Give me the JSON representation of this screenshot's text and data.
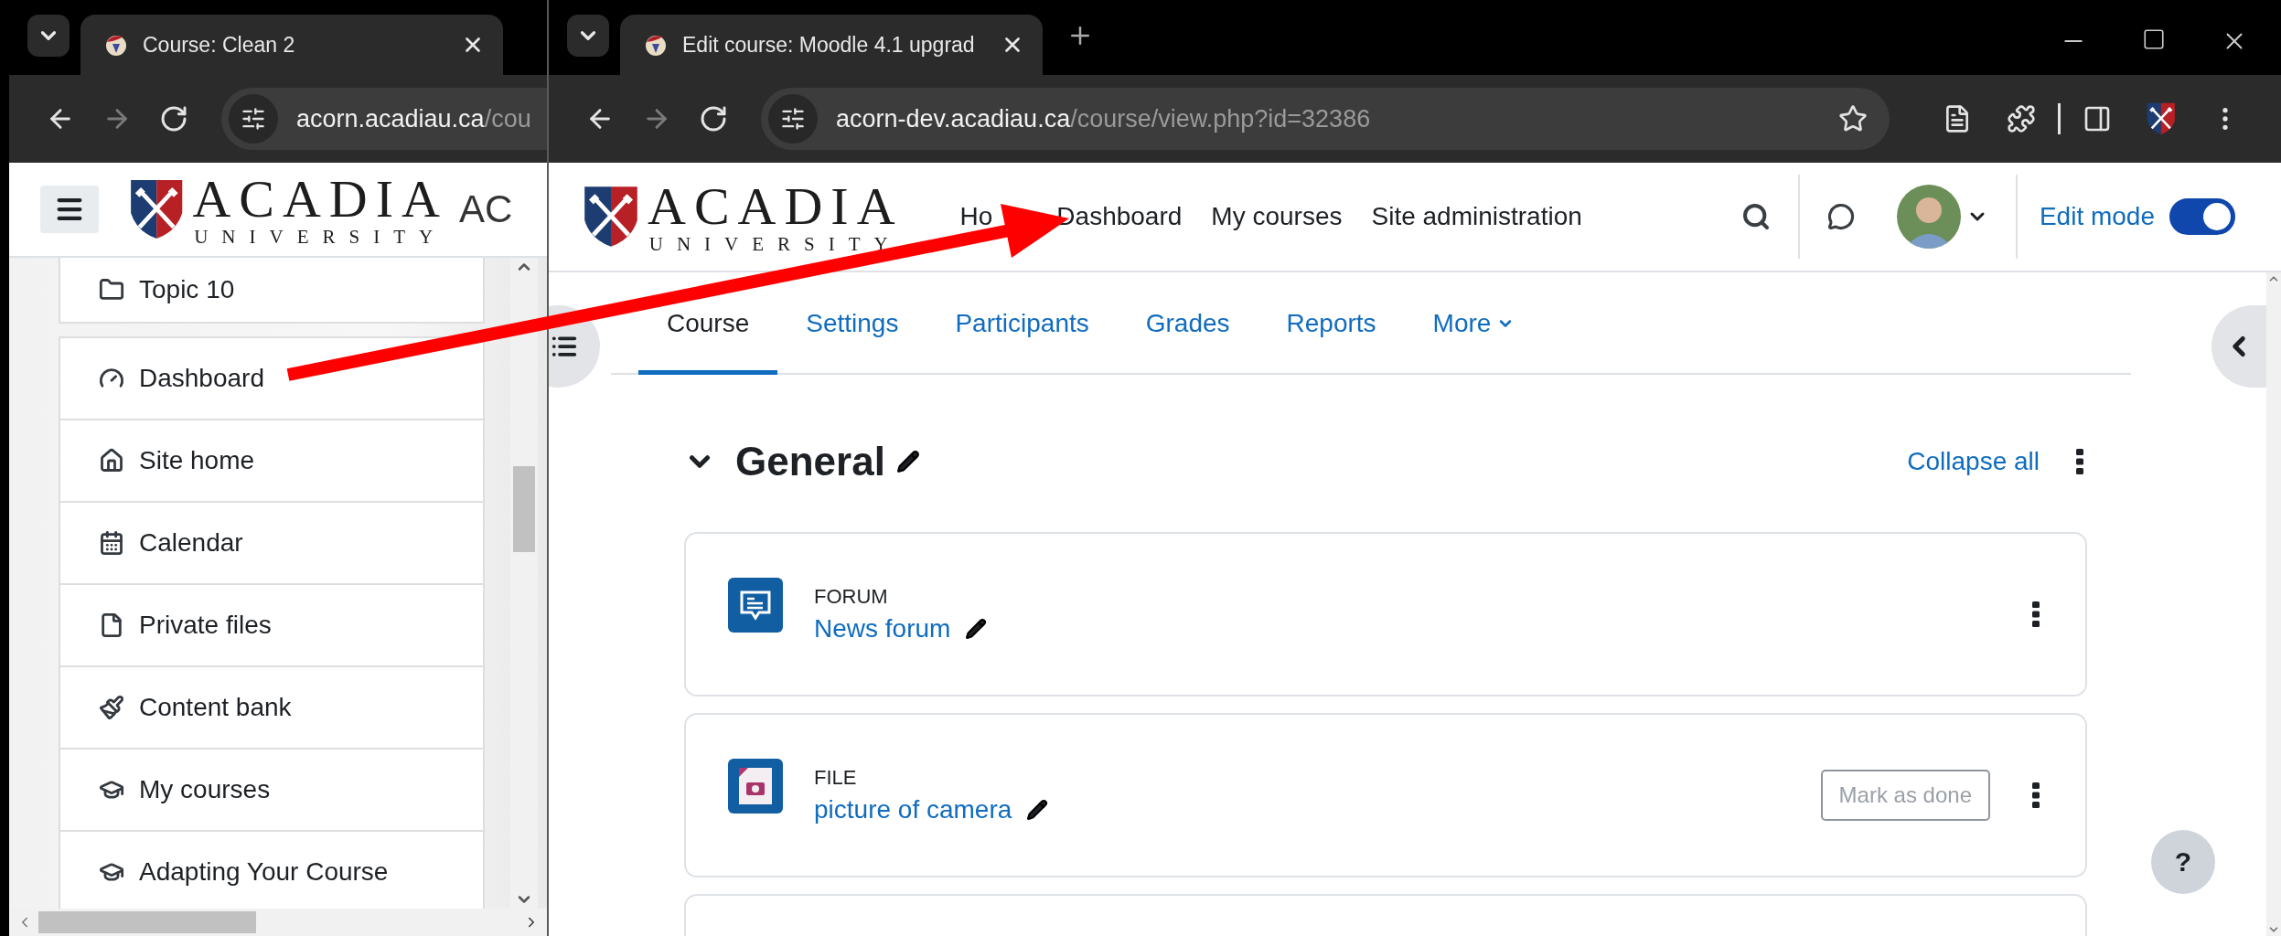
{
  "left_window": {
    "tab": {
      "title": "Course: Clean 2"
    },
    "nav_buttons": [
      {
        "kind": "back",
        "disabled": false
      },
      {
        "kind": "forward",
        "disabled": true
      },
      {
        "kind": "reload",
        "disabled": false
      }
    ],
    "address": {
      "host": "acorn.acadiau.ca",
      "path": "/cou"
    },
    "header": {
      "logo_name": "ACADIA",
      "logo_sub": "UNIVERSITY",
      "site_title": "AC"
    },
    "sidebar": {
      "sections": [
        {
          "items": [
            {
              "kind": "folder",
              "label": "Topic 10"
            }
          ]
        },
        {
          "items": [
            {
              "kind": "dashboard",
              "label": "Dashboard"
            },
            {
              "kind": "home",
              "label": "Site home"
            },
            {
              "kind": "calendar",
              "label": "Calendar"
            },
            {
              "kind": "file",
              "label": "Private files"
            },
            {
              "kind": "brush",
              "label": "Content bank"
            },
            {
              "kind": "courses",
              "label": "My courses"
            },
            {
              "kind": "course",
              "label": "Adapting Your Course"
            }
          ]
        }
      ]
    }
  },
  "right_window": {
    "tab": {
      "title": "Edit course: Moodle 4.1 upgrad"
    },
    "nav_buttons": [
      {
        "kind": "back",
        "disabled": false
      },
      {
        "kind": "forward",
        "disabled": true
      },
      {
        "kind": "reload",
        "disabled": false
      }
    ],
    "address": {
      "host": "acorn-dev.acadiau.ca",
      "path": "/course/view.php?id=32386"
    },
    "header": {
      "logo_name": "ACADIA",
      "logo_sub": "UNIVERSITY",
      "nav": [
        {
          "label": "Ho"
        },
        {
          "label": "Dashboard"
        },
        {
          "label": "My courses"
        },
        {
          "label": "Site administration"
        }
      ],
      "edit_mode": {
        "label": "Edit mode",
        "on": true
      }
    },
    "course_tabs": [
      {
        "label": "Course",
        "selected": true,
        "kind": "link"
      },
      {
        "label": "Settings",
        "selected": false,
        "kind": "link"
      },
      {
        "label": "Participants",
        "selected": false,
        "kind": "link"
      },
      {
        "label": "Grades",
        "selected": false,
        "kind": "link"
      },
      {
        "label": "Reports",
        "selected": false,
        "kind": "link"
      },
      {
        "label": "More",
        "selected": false,
        "kind": "menu"
      }
    ],
    "section": {
      "title": "General",
      "expanded": true,
      "collapse_link": "Collapse all"
    },
    "activities": [
      {
        "kind": "forum",
        "type": "FORUM",
        "name": "News forum"
      },
      {
        "kind": "file",
        "type": "FILE",
        "name": "picture of camera",
        "completion_button": "Mark as done"
      }
    ],
    "help_button": "?"
  }
}
